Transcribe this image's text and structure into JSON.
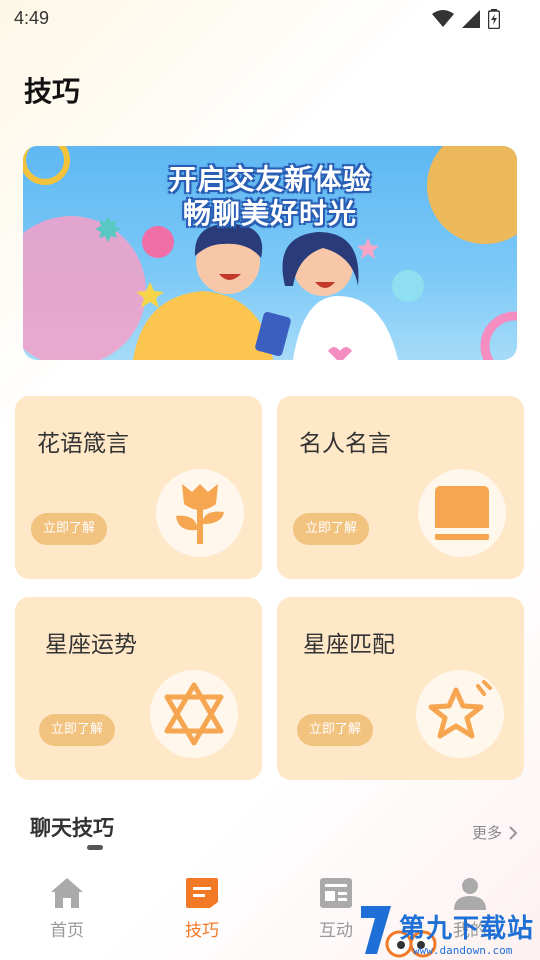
{
  "status_bar": {
    "time": "4:49"
  },
  "page": {
    "title": "技巧"
  },
  "banner": {
    "line1": "开启交友新体验",
    "line2": "畅聊美好时光"
  },
  "cards": [
    {
      "title": "花语箴言",
      "button": "立即了解",
      "icon": "flower-icon"
    },
    {
      "title": "名人名言",
      "button": "立即了解",
      "icon": "book-icon"
    },
    {
      "title": "星座运势",
      "button": "立即了解",
      "icon": "hexagram-icon"
    },
    {
      "title": "星座匹配",
      "button": "立即了解",
      "icon": "star-icon"
    }
  ],
  "section": {
    "title": "聊天技巧",
    "more": "更多"
  },
  "tabs": [
    {
      "label": "首页",
      "icon": "home-icon"
    },
    {
      "label": "技巧",
      "icon": "tips-icon"
    },
    {
      "label": "互动",
      "icon": "interaction-icon"
    },
    {
      "label": "我的",
      "icon": "profile-icon"
    }
  ],
  "watermark": {
    "text": "第九下载站",
    "url": "www.dandown.com"
  },
  "colors": {
    "accent": "#f27a27",
    "card_bg": "#fee8c8",
    "icon_orange": "#f6a650",
    "button_bg": "#f2c27f"
  }
}
